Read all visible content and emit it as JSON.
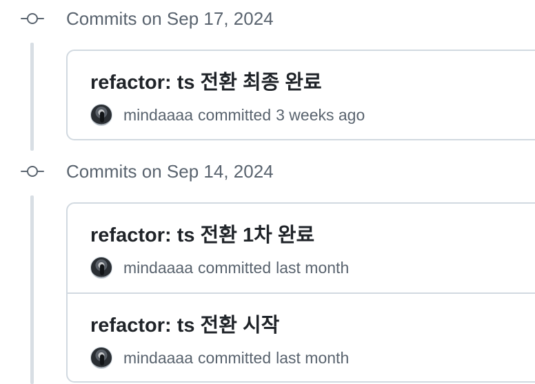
{
  "groups": [
    {
      "title": "Commits on Sep 17, 2024",
      "commits": [
        {
          "message": "refactor: ts 전환 최종 완료",
          "author": "mindaaaa",
          "action": "committed",
          "time": "3 weeks ago"
        }
      ]
    },
    {
      "title": "Commits on Sep 14, 2024",
      "commits": [
        {
          "message": "refactor: ts 전환 1차 완료",
          "author": "mindaaaa",
          "action": "committed",
          "time": "last month"
        },
        {
          "message": "refactor: ts 전환 시작",
          "author": "mindaaaa",
          "action": "committed",
          "time": "last month"
        }
      ]
    }
  ],
  "icons": {
    "group_icon": "git-commit-icon",
    "avatar": "user-avatar"
  },
  "colors": {
    "text_primary": "#1f2328",
    "text_muted": "#59636e",
    "border": "#d1d9e0",
    "timeline": "#d8dee4"
  }
}
